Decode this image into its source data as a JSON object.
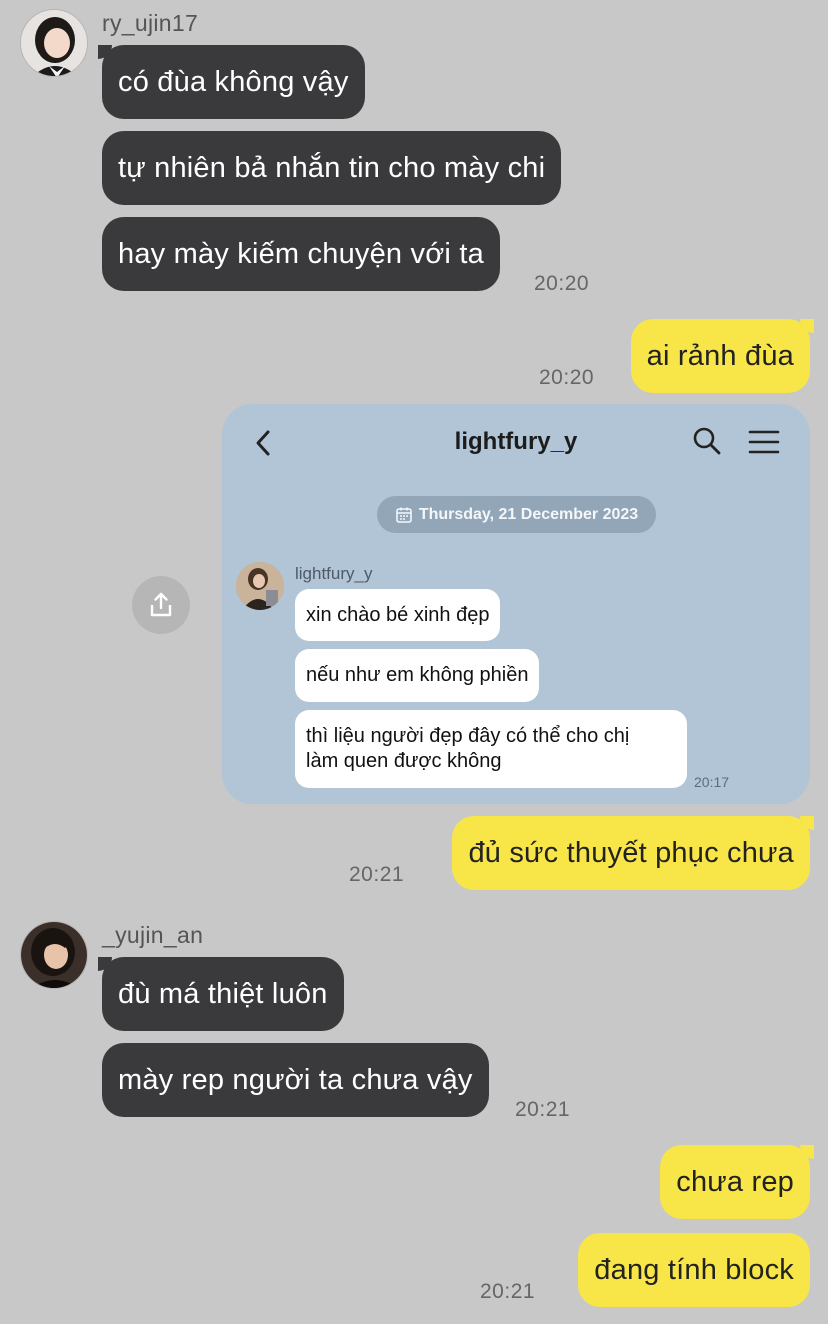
{
  "messages": {
    "user1": "ry_ujin17",
    "m1": "có đùa không vậy",
    "m2": "tự nhiên bả nhắn tin cho mày chi",
    "m3": "hay mày kiếm chuyện với ta",
    "t1": "20:20",
    "r1": "ai rảnh đùa",
    "t2": "20:20",
    "r2": "đủ sức thuyết phục chưa",
    "t3": "20:21",
    "user2": "_yujin_an",
    "m4": "đù má thiệt luôn",
    "m5": "mày rep người ta chưa vậy",
    "t4": "20:21",
    "r3": "chưa rep",
    "r4": "đang tính block",
    "t5": "20:21"
  },
  "shared": {
    "title": "lightfury_y",
    "date": "Thursday, 21 December 2023",
    "username": "lightfury_y",
    "b1": "xin chào bé xinh đẹp",
    "b2": "nếu như em không phiền",
    "b3_line1": "thì liệu người đẹp đây có thể cho chị",
    "b3_line2": "làm quen được không",
    "time": "20:17"
  },
  "icons": {
    "share": "share-icon",
    "back": "back-chevron-icon",
    "search": "search-icon",
    "menu": "menu-icon",
    "calendar": "calendar-icon"
  },
  "colors": {
    "background": "#c8c8c8",
    "incoming_bubble": "#3a3a3c",
    "outgoing_bubble": "#f8e547",
    "card_background": "#b2c5d7"
  }
}
